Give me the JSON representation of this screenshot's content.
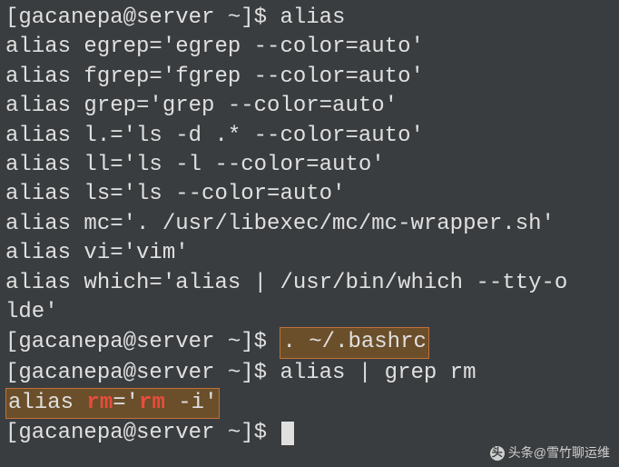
{
  "prompt1": "[gacanepa@server ~]$ alias",
  "aliases": [
    "alias egrep='egrep --color=auto'",
    "alias fgrep='fgrep --color=auto'",
    "alias grep='grep --color=auto'",
    "alias l.='ls -d .* --color=auto'",
    "alias ll='ls -l --color=auto'",
    "alias ls='ls --color=auto'",
    "alias mc='. /usr/libexec/mc/mc-wrapper.sh'",
    "alias vi='vim'",
    "alias which='alias | /usr/bin/which --tty-o",
    "lde'"
  ],
  "prompt2_pre": "[gacanepa@server ~]$ ",
  "prompt2_cmd": ". ~/.bashrc",
  "prompt3": "[gacanepa@server ~]$ alias | grep rm",
  "rm_alias": {
    "pre": "alias ",
    "rm1": "rm",
    "mid": "='",
    "rm2": "rm",
    "post": " -i'"
  },
  "prompt4": "[gacanepa@server ~]$ ",
  "watermark": "头条@雪竹聊运维"
}
